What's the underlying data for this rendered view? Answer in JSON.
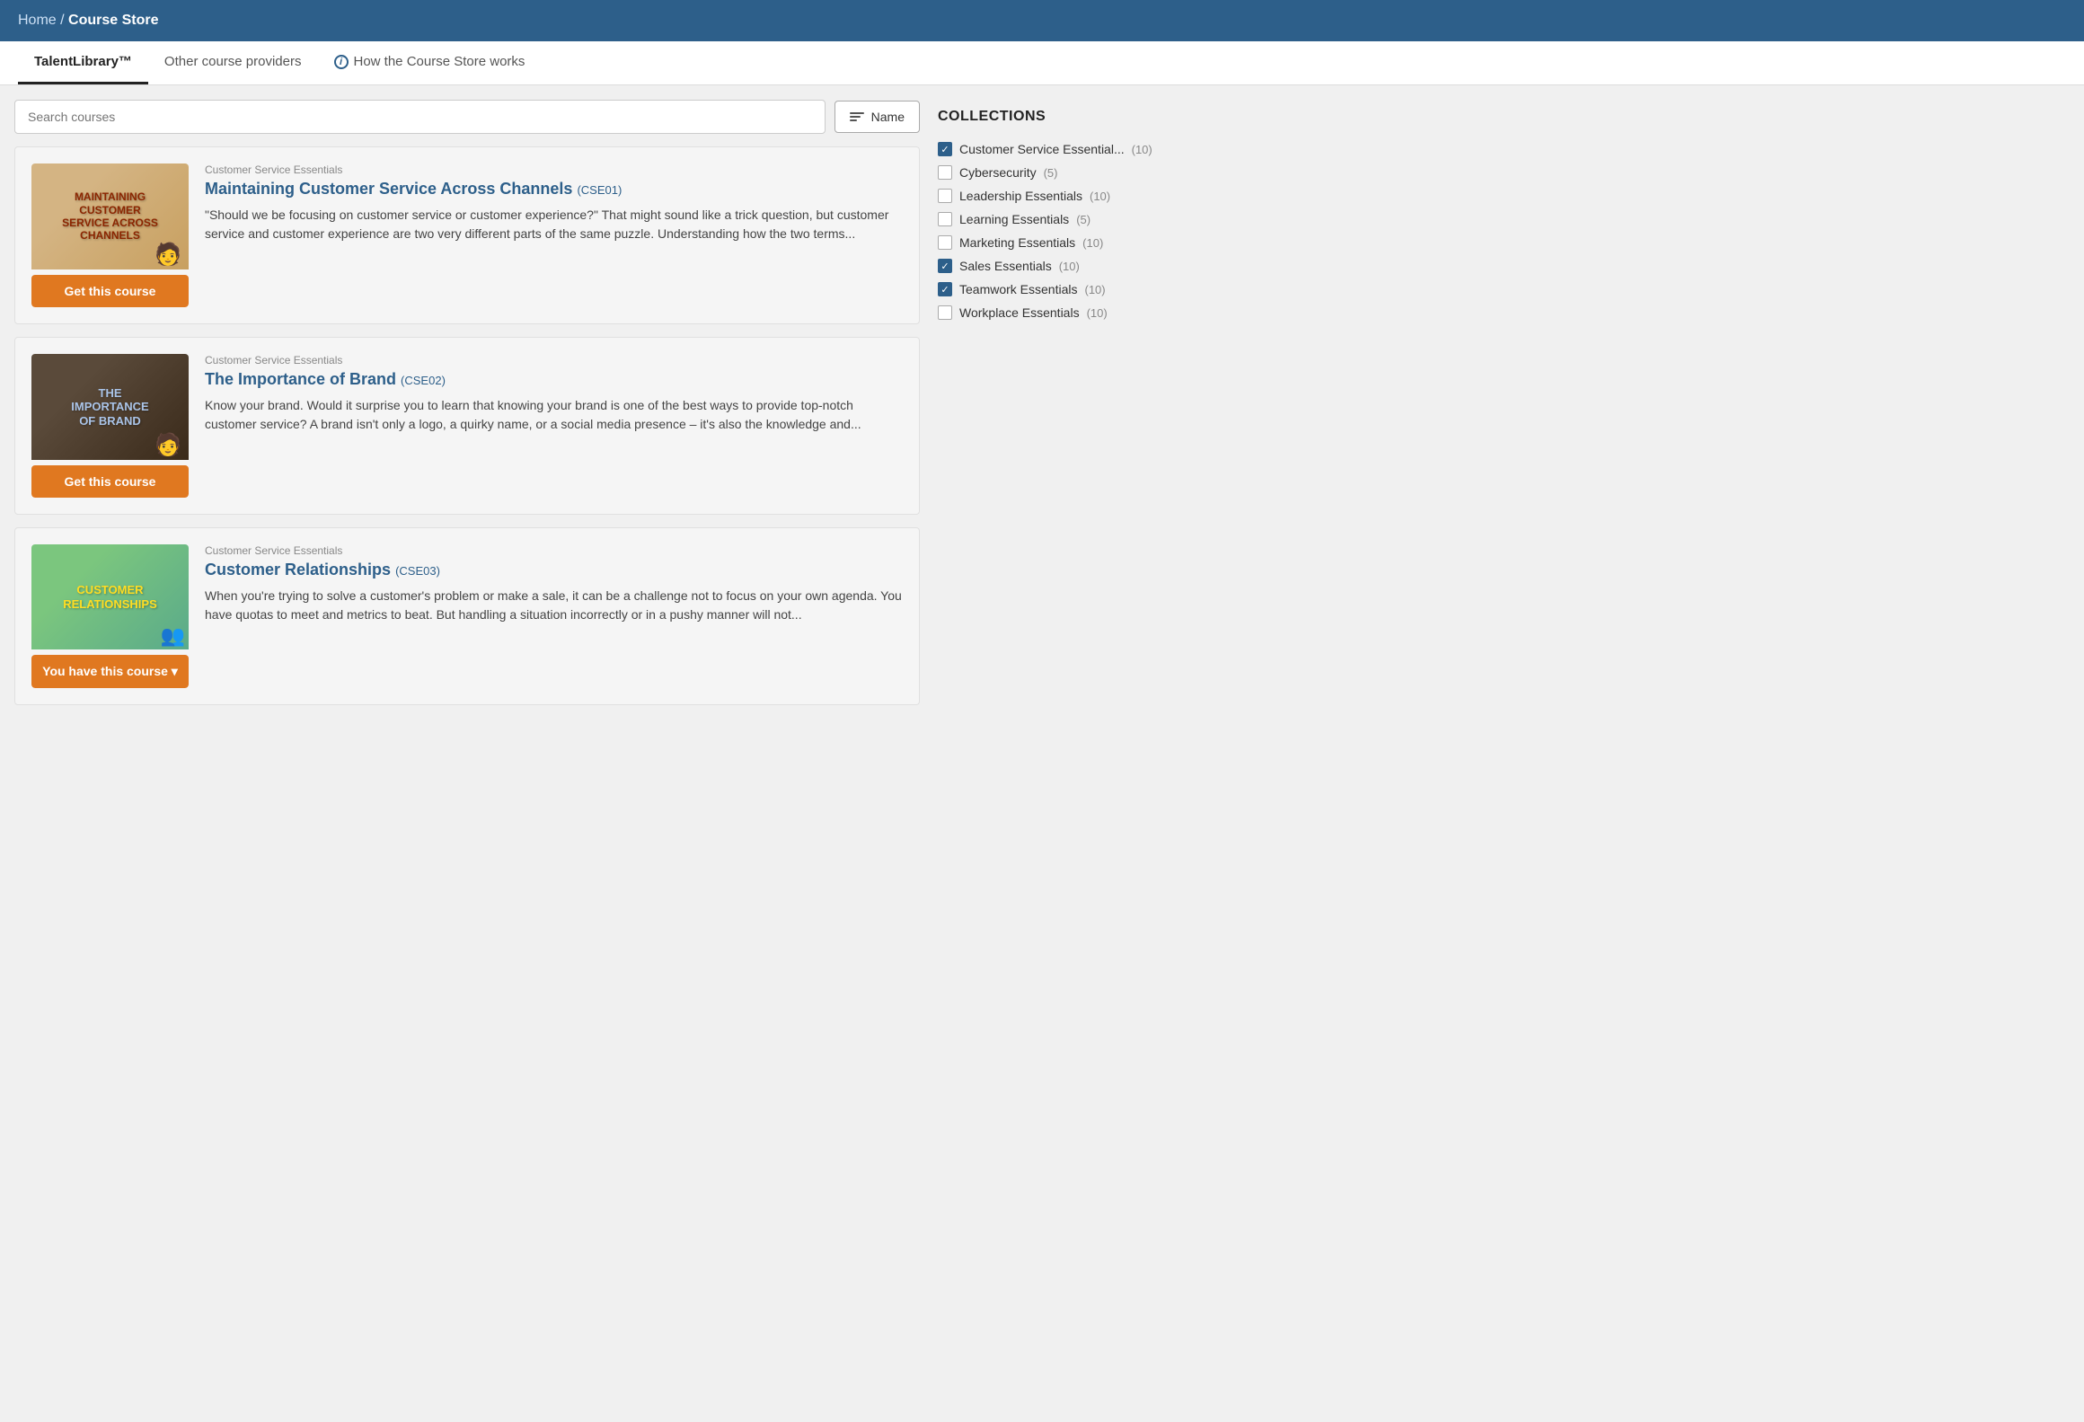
{
  "header": {
    "breadcrumb_home": "Home",
    "breadcrumb_separator": " / ",
    "breadcrumb_current": "Course Store"
  },
  "tabs": [
    {
      "id": "talent-library",
      "label": "TalentLibrary™",
      "active": true,
      "has_info": false
    },
    {
      "id": "other-providers",
      "label": "Other course providers",
      "active": false,
      "has_info": false
    },
    {
      "id": "how-it-works",
      "label": "How the Course Store works",
      "active": false,
      "has_info": true
    }
  ],
  "search": {
    "placeholder": "Search courses"
  },
  "sort_button": {
    "label": "Name"
  },
  "collections_title": "COLLECTIONS",
  "collections": [
    {
      "id": "customer-service",
      "label": "Customer Service Essential...",
      "count": "(10)",
      "checked": true
    },
    {
      "id": "cybersecurity",
      "label": "Cybersecurity",
      "count": "(5)",
      "checked": false
    },
    {
      "id": "leadership",
      "label": "Leadership Essentials",
      "count": "(10)",
      "checked": false
    },
    {
      "id": "learning",
      "label": "Learning Essentials",
      "count": "(5)",
      "checked": false
    },
    {
      "id": "marketing",
      "label": "Marketing Essentials",
      "count": "(10)",
      "checked": false
    },
    {
      "id": "sales",
      "label": "Sales Essentials",
      "count": "(10)",
      "checked": true
    },
    {
      "id": "teamwork",
      "label": "Teamwork Essentials",
      "count": "(10)",
      "checked": true
    },
    {
      "id": "workplace",
      "label": "Workplace Essentials",
      "count": "(10)",
      "checked": false
    }
  ],
  "courses": [
    {
      "id": "cse01",
      "collection": "Customer Service Essentials",
      "title": "Maintaining Customer Service Across Channels",
      "code": "(CSE01)",
      "description": "\"Should we be focusing on customer service or customer experience?\" That might sound like a trick question, but customer service and customer experience are two very different parts of the same puzzle. Understanding how the two terms...",
      "button_label": "Get this course",
      "button_type": "get",
      "thumb_class": "cse01",
      "thumb_text": "MAINTAINING\nCUSTOMER\nSERVICE ACROSS\nCHANNELS"
    },
    {
      "id": "cse02",
      "collection": "Customer Service Essentials",
      "title": "The Importance of Brand",
      "code": "(CSE02)",
      "description": "Know your brand. Would it surprise you to learn that knowing your brand is one of the best ways to provide top-notch customer service? A brand isn't only a logo, a quirky name, or a social media presence – it's also the knowledge and...",
      "button_label": "Get this course",
      "button_type": "get",
      "thumb_class": "cse02",
      "thumb_text": "THE\nIMPORTANCE\nOF BRAND"
    },
    {
      "id": "cse03",
      "collection": "Customer Service Essentials",
      "title": "Customer Relationships",
      "code": "(CSE03)",
      "description": "When you're trying to solve a customer's problem or make a sale, it can be a challenge not to focus on your own agenda. You have quotas to meet and metrics to beat. But handling a situation incorrectly or in a pushy manner will not...",
      "button_label": "You have this course",
      "button_type": "owned",
      "thumb_class": "cse03",
      "thumb_text": "CUSTOMER\nRELATIONSHIPS"
    }
  ]
}
